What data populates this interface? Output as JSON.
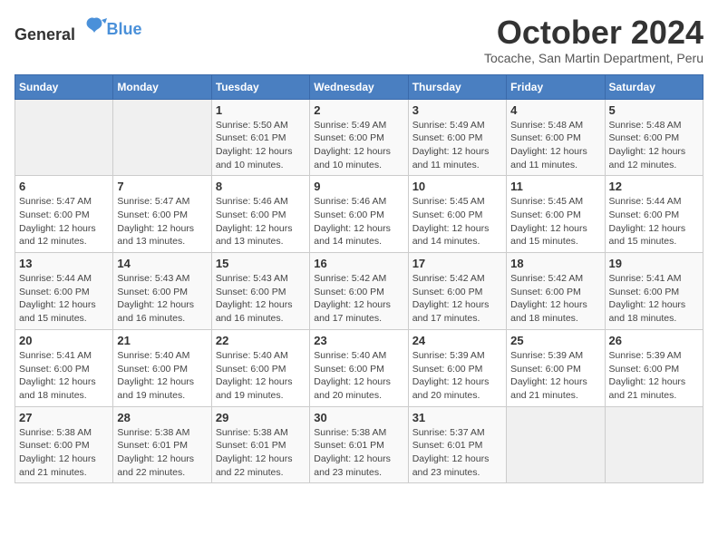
{
  "logo": {
    "text_general": "General",
    "text_blue": "Blue"
  },
  "title": {
    "month": "October 2024",
    "location": "Tocache, San Martin Department, Peru"
  },
  "weekdays": [
    "Sunday",
    "Monday",
    "Tuesday",
    "Wednesday",
    "Thursday",
    "Friday",
    "Saturday"
  ],
  "weeks": [
    [
      {
        "day": "",
        "info": ""
      },
      {
        "day": "",
        "info": ""
      },
      {
        "day": "1",
        "info": "Sunrise: 5:50 AM\nSunset: 6:01 PM\nDaylight: 12 hours\nand 10 minutes."
      },
      {
        "day": "2",
        "info": "Sunrise: 5:49 AM\nSunset: 6:00 PM\nDaylight: 12 hours\nand 10 minutes."
      },
      {
        "day": "3",
        "info": "Sunrise: 5:49 AM\nSunset: 6:00 PM\nDaylight: 12 hours\nand 11 minutes."
      },
      {
        "day": "4",
        "info": "Sunrise: 5:48 AM\nSunset: 6:00 PM\nDaylight: 12 hours\nand 11 minutes."
      },
      {
        "day": "5",
        "info": "Sunrise: 5:48 AM\nSunset: 6:00 PM\nDaylight: 12 hours\nand 12 minutes."
      }
    ],
    [
      {
        "day": "6",
        "info": "Sunrise: 5:47 AM\nSunset: 6:00 PM\nDaylight: 12 hours\nand 12 minutes."
      },
      {
        "day": "7",
        "info": "Sunrise: 5:47 AM\nSunset: 6:00 PM\nDaylight: 12 hours\nand 13 minutes."
      },
      {
        "day": "8",
        "info": "Sunrise: 5:46 AM\nSunset: 6:00 PM\nDaylight: 12 hours\nand 13 minutes."
      },
      {
        "day": "9",
        "info": "Sunrise: 5:46 AM\nSunset: 6:00 PM\nDaylight: 12 hours\nand 14 minutes."
      },
      {
        "day": "10",
        "info": "Sunrise: 5:45 AM\nSunset: 6:00 PM\nDaylight: 12 hours\nand 14 minutes."
      },
      {
        "day": "11",
        "info": "Sunrise: 5:45 AM\nSunset: 6:00 PM\nDaylight: 12 hours\nand 15 minutes."
      },
      {
        "day": "12",
        "info": "Sunrise: 5:44 AM\nSunset: 6:00 PM\nDaylight: 12 hours\nand 15 minutes."
      }
    ],
    [
      {
        "day": "13",
        "info": "Sunrise: 5:44 AM\nSunset: 6:00 PM\nDaylight: 12 hours\nand 15 minutes."
      },
      {
        "day": "14",
        "info": "Sunrise: 5:43 AM\nSunset: 6:00 PM\nDaylight: 12 hours\nand 16 minutes."
      },
      {
        "day": "15",
        "info": "Sunrise: 5:43 AM\nSunset: 6:00 PM\nDaylight: 12 hours\nand 16 minutes."
      },
      {
        "day": "16",
        "info": "Sunrise: 5:42 AM\nSunset: 6:00 PM\nDaylight: 12 hours\nand 17 minutes."
      },
      {
        "day": "17",
        "info": "Sunrise: 5:42 AM\nSunset: 6:00 PM\nDaylight: 12 hours\nand 17 minutes."
      },
      {
        "day": "18",
        "info": "Sunrise: 5:42 AM\nSunset: 6:00 PM\nDaylight: 12 hours\nand 18 minutes."
      },
      {
        "day": "19",
        "info": "Sunrise: 5:41 AM\nSunset: 6:00 PM\nDaylight: 12 hours\nand 18 minutes."
      }
    ],
    [
      {
        "day": "20",
        "info": "Sunrise: 5:41 AM\nSunset: 6:00 PM\nDaylight: 12 hours\nand 18 minutes."
      },
      {
        "day": "21",
        "info": "Sunrise: 5:40 AM\nSunset: 6:00 PM\nDaylight: 12 hours\nand 19 minutes."
      },
      {
        "day": "22",
        "info": "Sunrise: 5:40 AM\nSunset: 6:00 PM\nDaylight: 12 hours\nand 19 minutes."
      },
      {
        "day": "23",
        "info": "Sunrise: 5:40 AM\nSunset: 6:00 PM\nDaylight: 12 hours\nand 20 minutes."
      },
      {
        "day": "24",
        "info": "Sunrise: 5:39 AM\nSunset: 6:00 PM\nDaylight: 12 hours\nand 20 minutes."
      },
      {
        "day": "25",
        "info": "Sunrise: 5:39 AM\nSunset: 6:00 PM\nDaylight: 12 hours\nand 21 minutes."
      },
      {
        "day": "26",
        "info": "Sunrise: 5:39 AM\nSunset: 6:00 PM\nDaylight: 12 hours\nand 21 minutes."
      }
    ],
    [
      {
        "day": "27",
        "info": "Sunrise: 5:38 AM\nSunset: 6:00 PM\nDaylight: 12 hours\nand 21 minutes."
      },
      {
        "day": "28",
        "info": "Sunrise: 5:38 AM\nSunset: 6:01 PM\nDaylight: 12 hours\nand 22 minutes."
      },
      {
        "day": "29",
        "info": "Sunrise: 5:38 AM\nSunset: 6:01 PM\nDaylight: 12 hours\nand 22 minutes."
      },
      {
        "day": "30",
        "info": "Sunrise: 5:38 AM\nSunset: 6:01 PM\nDaylight: 12 hours\nand 23 minutes."
      },
      {
        "day": "31",
        "info": "Sunrise: 5:37 AM\nSunset: 6:01 PM\nDaylight: 12 hours\nand 23 minutes."
      },
      {
        "day": "",
        "info": ""
      },
      {
        "day": "",
        "info": ""
      }
    ]
  ]
}
